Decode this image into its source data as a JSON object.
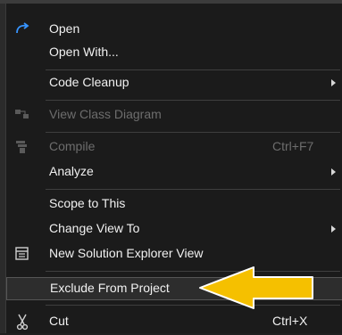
{
  "menu": {
    "open": "Open",
    "open_with": "Open With...",
    "code_cleanup": "Code Cleanup",
    "view_class_diagram": "View Class Diagram",
    "compile": "Compile",
    "compile_shortcut": "Ctrl+F7",
    "analyze": "Analyze",
    "scope_to_this": "Scope to This",
    "change_view_to": "Change View To",
    "new_solution_explorer_view": "New Solution Explorer View",
    "exclude_from_project": "Exclude From Project",
    "cut": "Cut",
    "cut_shortcut": "Ctrl+X"
  },
  "icons": {
    "open": "open-arrow-icon",
    "view_class_diagram": "class-diagram-icon",
    "compile": "compile-icon",
    "new_solution_explorer_view": "solution-explorer-icon",
    "cut": "scissors-icon",
    "pointer": "pointer-arrow-icon"
  },
  "colors": {
    "accent": "#3794ff",
    "pointer": "#f5c000",
    "menu_bg": "#1b1b1b",
    "text": "#f1f1f1",
    "disabled_text": "#6d6d6d"
  }
}
